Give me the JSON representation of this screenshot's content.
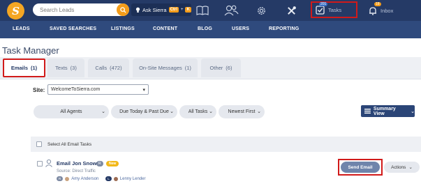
{
  "header": {
    "logo_letter": "S",
    "search": {
      "placeholder": "Search Leads"
    },
    "ask": {
      "label": "Ask Sierra",
      "key1": "Ctrl",
      "plus": "+",
      "key2": "K"
    },
    "tasks": {
      "label": "Tasks",
      "count": "201"
    },
    "inbox": {
      "label": "Inbox",
      "count": "18"
    }
  },
  "nav": {
    "items": [
      "LEADS",
      "SAVED SEARCHES",
      "LISTINGS",
      "CONTENT",
      "BLOG",
      "USERS",
      "REPORTING"
    ]
  },
  "page": {
    "title": "Task Manager"
  },
  "tabs": [
    {
      "label": "Emails",
      "count": "(1)"
    },
    {
      "label": "Texts",
      "count": "(3)"
    },
    {
      "label": "Calls",
      "count": "(472)"
    },
    {
      "label": "On-Site Messages",
      "count": "(1)"
    },
    {
      "label": "Other",
      "count": "(6)"
    }
  ],
  "site": {
    "label": "Site:",
    "value": "WelcomeToSierra.com"
  },
  "filters": {
    "agents": "All Agents",
    "due": "Due Today & Past Due",
    "tasks": "All Tasks",
    "sort": "Newest First",
    "view": "Summary View"
  },
  "select_all": "Select All Email Tasks",
  "task": {
    "title": "Email Jon Snow",
    "r_badge": "R",
    "new_badge": "New",
    "source": "Source: Direct Traffic",
    "agent_badge": "R",
    "agent": "Amy Anderson",
    "lender_badge": "L",
    "lender": "Lenny Lender",
    "send": "Send Email",
    "actions": "Actions"
  },
  "colors": {
    "topbar": "#253a66",
    "nav": "#2f4a7d",
    "accent": "#f39c1a",
    "highlight": "#d11a1a"
  }
}
